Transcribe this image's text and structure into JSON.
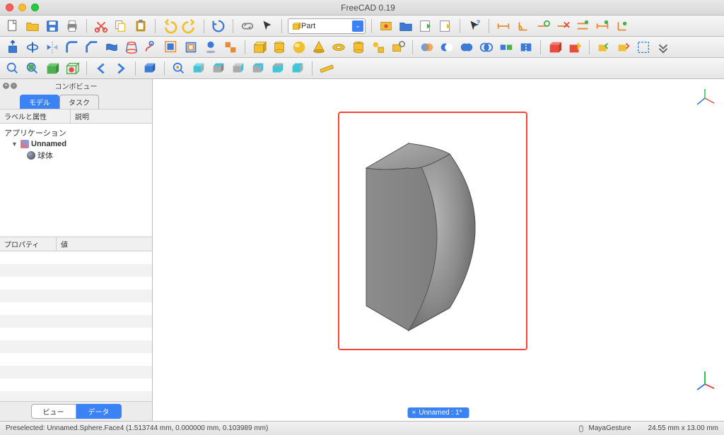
{
  "window": {
    "title": "FreeCAD 0.19"
  },
  "workbench": {
    "label": "Part",
    "icon": "part-icon"
  },
  "combo": {
    "title": "コンボビュー",
    "tabs": {
      "model": "モデル",
      "task": "タスク",
      "active": "model"
    },
    "tree_headers": {
      "label": "ラベルと属性",
      "desc": "説明"
    },
    "tree": {
      "root": "アプリケーション",
      "doc": "Unnamed",
      "item": "球体"
    },
    "prop_headers": {
      "prop": "プロパティ",
      "val": "値"
    },
    "bottom_tabs": {
      "view": "ビュー",
      "data": "データ",
      "active": "data"
    }
  },
  "document_tab": {
    "label": "Unnamed : 1*",
    "close": "×"
  },
  "status": {
    "preselect": "Preselected: Unnamed.Sphere.Face4 (1.513744 mm, 0.000000 mm, 0.103989 mm)",
    "nav_style": "MayaGesture",
    "dimensions": "24.55 mm x 13.00 mm"
  },
  "icon_colors": {
    "blue": "#3b7bd6",
    "dblue": "#2a5fa8",
    "yellow": "#f0c030",
    "orange": "#e88b2e",
    "green": "#4caf50",
    "red": "#e74c3c",
    "gray": "#888",
    "cyan": "#3ec5d8"
  }
}
